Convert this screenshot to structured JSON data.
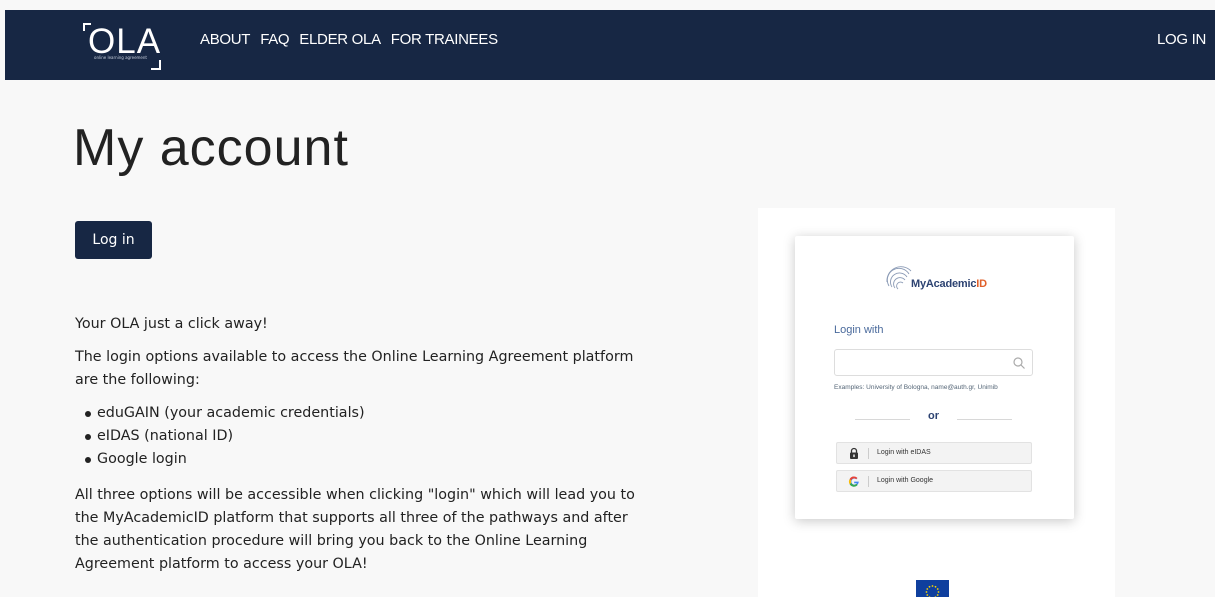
{
  "nav": {
    "logo_text": "OLA",
    "logo_tagline": "online learning agreement",
    "links": [
      "ABOUT",
      "FAQ",
      "ELDER OLA",
      "FOR TRAINEES"
    ],
    "login": "LOG IN"
  },
  "page": {
    "title": "My account",
    "login_button": "Log in",
    "intro": "Your OLA just a click away!",
    "options_text": "The login options available to access the Online Learning Agreement platform are the following:",
    "options": [
      "eduGAIN (your academic credentials)",
      "eIDAS (national ID)",
      "Google login"
    ],
    "closing_text": "All three options will be accessible when clicking \"login\" which will lead you to the MyAcademicID platform that supports all three of the pathways and after the authentication procedure will bring you back to the Online Learning Agreement platform to access your OLA!"
  },
  "preview": {
    "brand": "MyAcademic",
    "brand_suffix": "ID",
    "login_with": "Login with",
    "search_placeholder": "",
    "examples": "Examples: University of Bologna, name@auth.gr, Unimib",
    "or": "or",
    "eidas_button": "Login with eIDAS",
    "google_button": "Login with Google"
  },
  "colors": {
    "navy": "#172744",
    "brand_blue": "#2d4372",
    "brand_orange": "#e0602b",
    "eu_blue": "#0f3f9e",
    "eu_gold": "#f5d200"
  },
  "icons": [
    "search-icon",
    "lock-icon",
    "google-icon",
    "eu-flag-icon"
  ]
}
